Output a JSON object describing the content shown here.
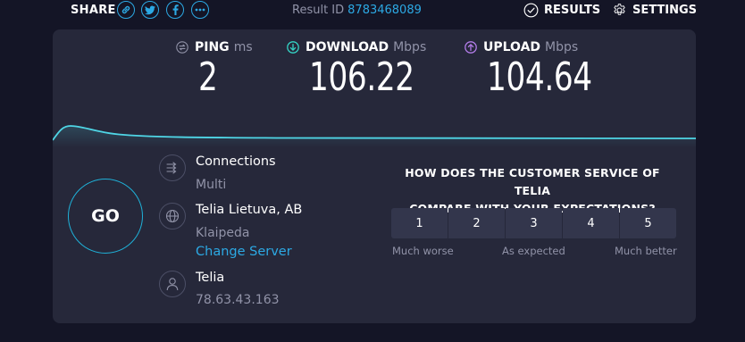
{
  "share": {
    "label": "SHARE",
    "buttons": [
      {
        "name": "link-icon"
      },
      {
        "name": "twitter-icon"
      },
      {
        "name": "facebook-icon"
      },
      {
        "name": "more-icon"
      }
    ]
  },
  "result": {
    "label": "Result ID",
    "id": "8783468089"
  },
  "nav": {
    "results_label": "RESULTS",
    "settings_label": "SETTINGS"
  },
  "metrics": {
    "ping": {
      "label": "PING",
      "unit": "ms",
      "value": "2"
    },
    "download": {
      "label": "DOWNLOAD",
      "unit": "Mbps",
      "value": "106.22"
    },
    "upload": {
      "label": "UPLOAD",
      "unit": "Mbps",
      "value": "104.64"
    }
  },
  "go_label": "GO",
  "connections": {
    "title": "Connections",
    "value": "Multi"
  },
  "server": {
    "name": "Telia Lietuva, AB",
    "location": "Klaipeda",
    "change_label": "Change Server"
  },
  "provider": {
    "name": "Telia",
    "ip": "78.63.43.163"
  },
  "survey": {
    "question_line1": "HOW DOES THE CUSTOMER SERVICE OF TELIA",
    "question_line2": "COMPARE WITH YOUR EXPECTATIONS?",
    "options": [
      "1",
      "2",
      "3",
      "4",
      "5"
    ],
    "low_label": "Much worse",
    "mid_label": "As expected",
    "high_label": "Much better"
  },
  "colors": {
    "background": "#141526",
    "panel": "#26283a",
    "accent_blue": "#2ca9e4",
    "go_ring": "#1fb1d8",
    "download_icon": "#34d3c4",
    "upload_icon": "#b27ce8",
    "graph_line": "#4fd6e6"
  }
}
